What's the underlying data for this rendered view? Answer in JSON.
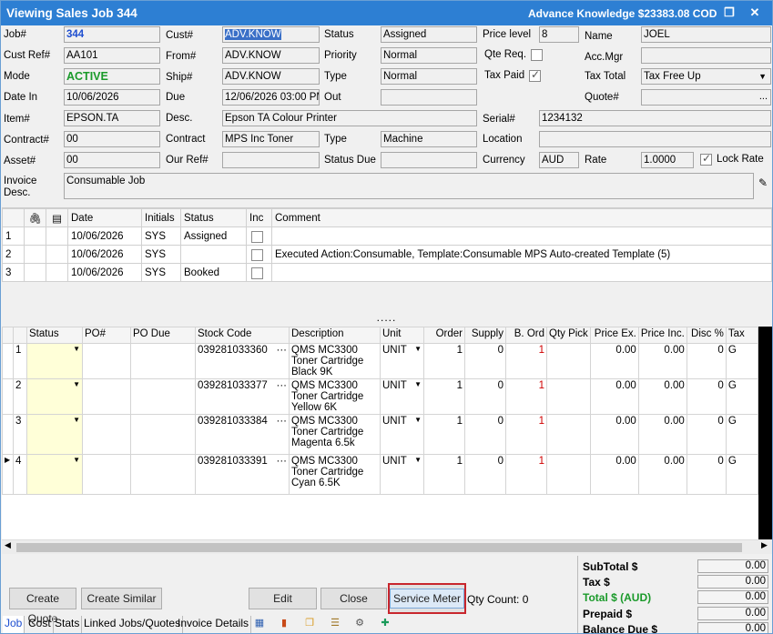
{
  "window": {
    "title": "Viewing Sales Job 344",
    "right_text": "Advance Knowledge $23383.08 COD",
    "restore_icon": "restore-icon",
    "close_icon": "close-icon"
  },
  "form": {
    "job_label": "Job#",
    "job_value": "344",
    "cust_label": "Cust#",
    "cust_value": "ADV.KNOW",
    "status_label": "Status",
    "status_value": "Assigned",
    "price_level_label": "Price level",
    "price_level_value": "8",
    "name_label": "Name",
    "name_value": "JOEL",
    "cust_ref_label": "Cust Ref#",
    "cust_ref_value": "AA101",
    "from_label": "From#",
    "from_value": "ADV.KNOW",
    "priority_label": "Priority",
    "priority_value": "Normal",
    "qte_req_label": "Qte Req.",
    "acc_mgr_label": "Acc.Mgr",
    "acc_mgr_value": "",
    "mode_label": "Mode",
    "mode_value": "ACTIVE",
    "ship_label": "Ship#",
    "ship_value": "ADV.KNOW",
    "type_label": "Type",
    "type_value": "Normal",
    "tax_paid_label": "Tax Paid",
    "tax_total_label": "Tax Total",
    "tax_total_value": "Tax Free Up",
    "date_in_label": "Date In",
    "date_in_value": "10/06/2026",
    "due_label": "Due",
    "due_value": "12/06/2026 03:00 PM",
    "out_label": "Out",
    "out_value": "",
    "quote_label": "Quote#",
    "quote_value": "",
    "item_label": "Item#",
    "item_value": "EPSON.TA",
    "desc_label": "Desc.",
    "desc_value": "Epson TA Colour Printer",
    "serial_label": "Serial#",
    "serial_value": "1234132",
    "contract_no_label": "Contract#",
    "contract_no_value": "00",
    "contract_label": "Contract",
    "contract_value": "MPS Inc Toner",
    "type2_label": "Type",
    "type2_value": "Machine",
    "location_label": "Location",
    "location_value": "",
    "asset_label": "Asset#",
    "asset_value": "00",
    "our_ref_label": "Our Ref#",
    "our_ref_value": "",
    "status_due_label": "Status Due",
    "status_due_value": "",
    "currency_label": "Currency",
    "currency_value": "AUD",
    "rate_label": "Rate",
    "rate_value": "1.0000",
    "lock_rate_label": "Lock Rate",
    "invoice_desc_label_1": "Invoice",
    "invoice_desc_label_2": "Desc.",
    "invoice_desc_value": "Consumable Job",
    "ellipsis": "..."
  },
  "history": {
    "headers": [
      "Date",
      "Initials",
      "Status",
      "Inc",
      "Comment"
    ],
    "rows": [
      {
        "n": "1",
        "date": "10/06/2026",
        "initials": "SYS",
        "status": "Assigned",
        "comment": ""
      },
      {
        "n": "2",
        "date": "10/06/2026",
        "initials": "SYS",
        "status": "",
        "comment": "Executed Action:Consumable, Template:Consumable MPS Auto-created Template (5)"
      },
      {
        "n": "3",
        "date": "10/06/2026",
        "initials": "SYS",
        "status": "Booked",
        "comment": ""
      }
    ]
  },
  "splitter": ".....",
  "lines": {
    "headers": [
      "Status",
      "PO#",
      "PO Due",
      "Stock Code",
      "Description",
      "Unit",
      "Order",
      "Supply",
      "B. Ord",
      "Qty Pick",
      "Price Ex.",
      "Price Inc.",
      "Disc %",
      "Tax"
    ],
    "rows": [
      {
        "n": "1",
        "stock": "039281033360",
        "desc": "QMS MC3300 Toner Cartridge Black 9K",
        "unit": "UNIT",
        "order": "1",
        "supply": "0",
        "bord": "1",
        "ex": "0.00",
        "inc": "0.00",
        "disc": "0",
        "tax": "G"
      },
      {
        "n": "2",
        "stock": "039281033377",
        "desc": "QMS MC3300 Toner Cartridge Yellow 6K",
        "unit": "UNIT",
        "order": "1",
        "supply": "0",
        "bord": "1",
        "ex": "0.00",
        "inc": "0.00",
        "disc": "0",
        "tax": "G"
      },
      {
        "n": "3",
        "stock": "039281033384",
        "desc": "QMS MC3300 Toner Cartridge Magenta 6.5k",
        "unit": "UNIT",
        "order": "1",
        "supply": "0",
        "bord": "1",
        "ex": "0.00",
        "inc": "0.00",
        "disc": "0",
        "tax": "G"
      },
      {
        "n": "4",
        "stock": "039281033391",
        "desc": "QMS MC3300 Toner Cartridge Cyan 6.5K",
        "unit": "UNIT",
        "order": "1",
        "supply": "0",
        "bord": "1",
        "ex": "0.00",
        "inc": "0.00",
        "disc": "0",
        "tax": "G"
      }
    ]
  },
  "buttons": {
    "create_quote": "Create Quote",
    "create_similar": "Create Similar",
    "edit": "Edit",
    "close": "Close",
    "service_meter": "Service Meter"
  },
  "qty_count": "Qty Count: 0",
  "tabs": [
    "Job",
    "Cost",
    "Stats",
    "Linked Jobs/Quotes",
    "Invoice Details"
  ],
  "totals": {
    "subtotal_label": "SubTotal $",
    "subtotal_value": "0.00",
    "tax_label": "Tax $",
    "tax_value": "0.00",
    "total_label": "Total   $ (AUD)",
    "total_value": "0.00",
    "prepaid_label": "Prepaid $",
    "prepaid_value": "0.00",
    "balance_label": "Balance Due $",
    "balance_value": "0.00"
  },
  "colors": {
    "titlebar": "#2d7fd3",
    "highlight": "#d00000",
    "active": "#1a9a2a"
  }
}
